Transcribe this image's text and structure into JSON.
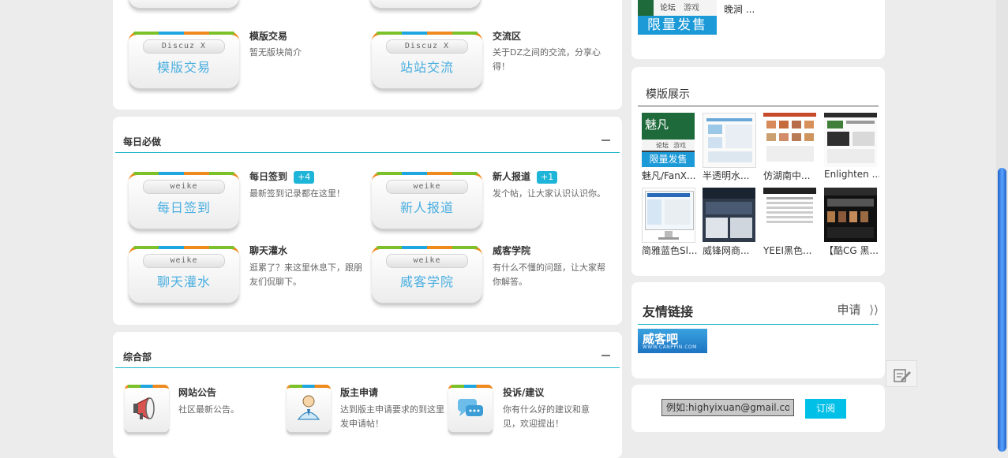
{
  "forums_top": [
    {
      "icon_top": "Discuz X",
      "icon_main": "模版交易",
      "name": "模版交易",
      "desc": "暂无版块简介"
    },
    {
      "icon_top": "Discuz X",
      "icon_main": "站站交流",
      "name": "交流区",
      "desc": "关于DZ之间的交流，分享心得！"
    }
  ],
  "daily": {
    "title": "每日必做",
    "forums": [
      {
        "icon_top": "weike",
        "icon_main": "每日签到",
        "name": "每日签到",
        "badge": "+4",
        "desc": "最新签到记录都在这里！"
      },
      {
        "icon_top": "weike",
        "icon_main": "新人报道",
        "name": "新人报道",
        "badge": "+1",
        "desc": "发个帖，让大家认识认识你。"
      },
      {
        "icon_top": "weike",
        "icon_main": "聊天灌水",
        "name": "聊天灌水",
        "desc": "逛累了？来这里休息下，跟朋友们侃聊下。"
      },
      {
        "icon_top": "weike",
        "icon_main": "威客学院",
        "name": "威客学院",
        "desc": "有什么不懂的问题，让大家帮你解答。"
      }
    ]
  },
  "general": {
    "title": "综合部",
    "forums": [
      {
        "name": "网站公告",
        "desc": "社区最新公告。",
        "icon": "megaphone-icon"
      },
      {
        "name": "版主申请",
        "desc": "达到版主申请要求的到这里发申请帖！",
        "icon": "user-icon"
      },
      {
        "name": "投诉/建议",
        "desc": "你有什么好的建议和意见，欢迎提出！",
        "icon": "chat-bubble-icon"
      }
    ]
  },
  "top_right": {
    "thumb_tags": [
      "论坛",
      "游戏"
    ],
    "thumb_banner": "限量发售",
    "caption": "晚涧 ..."
  },
  "templates": {
    "title": "模版展示",
    "items": [
      {
        "caption": "魅凡/FanX...",
        "logo": "魅凡",
        "tags": [
          "论坛",
          "游戏"
        ],
        "banner": "限量发售"
      },
      {
        "caption": "半透明水..."
      },
      {
        "caption": "仿湖南中..."
      },
      {
        "caption": "Enlighten ..."
      },
      {
        "caption": "简雅蓝色Sl..."
      },
      {
        "caption": "威锋网商..."
      },
      {
        "caption": "YEEI黑色..."
      },
      {
        "caption": "【酷CG 黑..."
      }
    ]
  },
  "links": {
    "title": "友情链接",
    "apply": "申请",
    "logo_main": "威客吧",
    "logo_sub": "WWW.CANPPIN.COM"
  },
  "subscribe": {
    "placeholder": "例如:highyixuan@gmail.com",
    "button": "订阅"
  },
  "colors": {
    "accent": "#1fb5c8",
    "badge": "#1fb5d8",
    "button": "#00c0e8"
  }
}
